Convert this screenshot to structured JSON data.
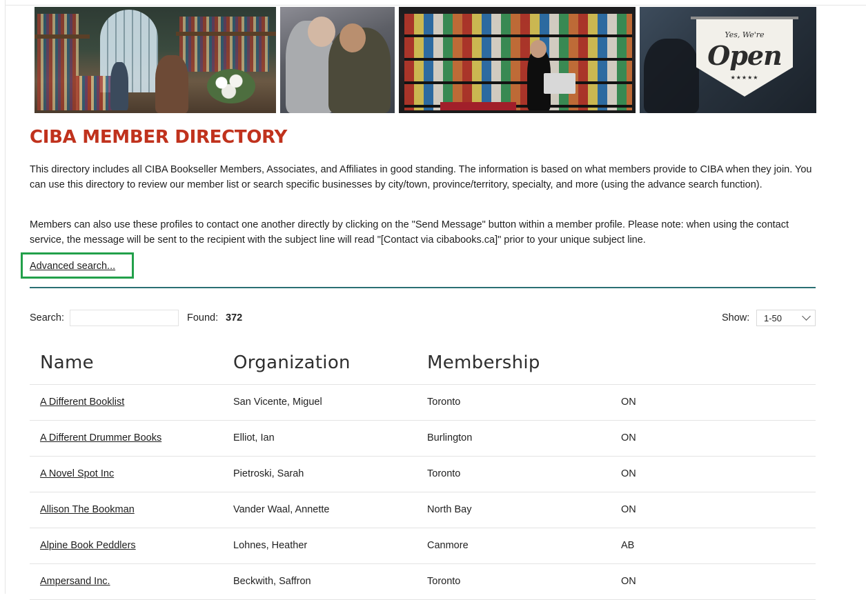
{
  "banner": {
    "sign_small": "Yes, We're",
    "sign_big": "Open",
    "sign_stars": "★★★★★"
  },
  "page_title": "CIBA MEMBER DIRECTORY",
  "intro": {
    "p1": "This directory includes all CIBA Bookseller Members, Associates, and Affiliates in good standing. The information is based on what members provide to CIBA when they join. You can use this directory to review our member list or search specific businesses by city/town, province/territory, specialty, and more (using the advance search function).",
    "p2": "Members can also use these profiles to contact one another directly by clicking on the \"Send Message\" button within a member profile. Please note: when using the contact service, the message will be sent to the recipient with the subject line will read \"[Contact via cibabooks.ca]\" prior to your unique subject line."
  },
  "advanced_search_label": "Advanced search...",
  "search": {
    "label": "Search:",
    "value": ""
  },
  "found": {
    "label": "Found:",
    "count": "372"
  },
  "show": {
    "label": "Show:",
    "selected": "1-50"
  },
  "colors": {
    "title": "#c0321d",
    "divider": "#2a6f73",
    "highlight": "#22a04a"
  },
  "table": {
    "headers": [
      "Name",
      "Organization",
      "Membership"
    ],
    "rows": [
      {
        "name": "A Different Booklist",
        "contact": "San Vicente, Miguel",
        "city": "Toronto",
        "province": "ON"
      },
      {
        "name": "A Different Drummer Books",
        "contact": "Elliot, Ian",
        "city": "Burlington",
        "province": "ON"
      },
      {
        "name": "A Novel Spot Inc",
        "contact": "Pietroski, Sarah",
        "city": "Toronto",
        "province": "ON"
      },
      {
        "name": "Allison The Bookman",
        "contact": "Vander Waal, Annette",
        "city": "North Bay",
        "province": "ON"
      },
      {
        "name": "Alpine Book Peddlers",
        "contact": "Lohnes, Heather",
        "city": "Canmore",
        "province": "AB"
      },
      {
        "name": "Ampersand Inc.",
        "contact": "Beckwith, Saffron",
        "city": "Toronto",
        "province": "ON"
      }
    ]
  }
}
